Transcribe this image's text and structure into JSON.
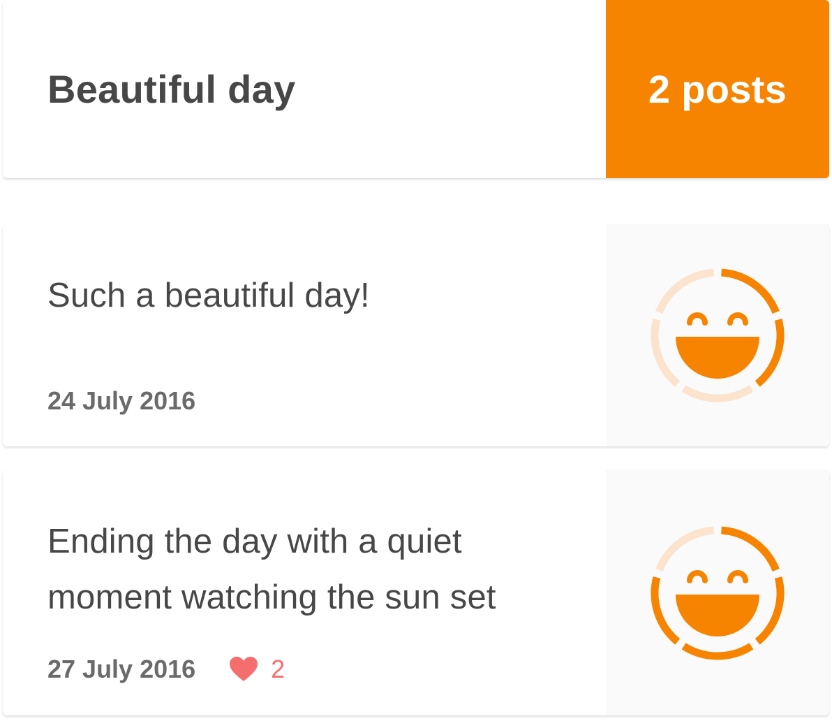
{
  "header": {
    "title": "Beautiful day",
    "post_count_label": "2 posts",
    "accent_color": "#f78400"
  },
  "posts": [
    {
      "text": "Such a beautiful day!",
      "date": "24 July 2016",
      "mood_icon": "laughing-face-icon",
      "mood_level_fraction": 0.4
    },
    {
      "text": "Ending the day with a quiet moment watching the sun set",
      "date": "27 July 2016",
      "likes": "2",
      "mood_icon": "laughing-face-icon",
      "mood_level_fraction": 0.8
    }
  ],
  "colors": {
    "accent": "#f78400",
    "ring_track": "#fbe3cd",
    "heart": "#f56d6d",
    "text": "#474747",
    "meta_text": "#6a6a6a"
  }
}
